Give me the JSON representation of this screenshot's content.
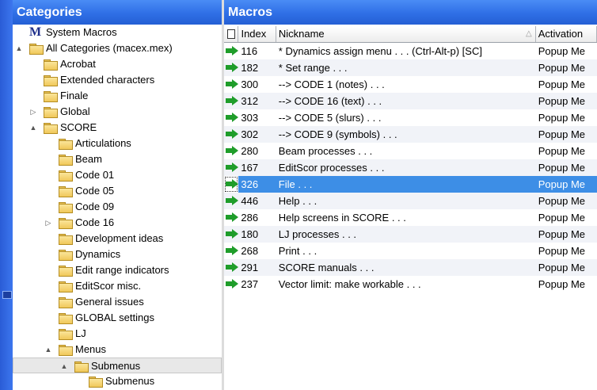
{
  "left_panel": {
    "title": "Categories",
    "tree": [
      {
        "label": "System Macros",
        "level": 0,
        "icon": "m-logo-icon",
        "expander": ""
      },
      {
        "label": "All Categories (macex.mex)",
        "level": 0,
        "icon": "folder-icon",
        "expander": "▲"
      },
      {
        "label": "Acrobat",
        "level": 1,
        "icon": "folder-icon",
        "expander": ""
      },
      {
        "label": "Extended characters",
        "level": 1,
        "icon": "folder-icon",
        "expander": ""
      },
      {
        "label": "Finale",
        "level": 1,
        "icon": "folder-icon",
        "expander": ""
      },
      {
        "label": "Global",
        "level": 1,
        "icon": "folder-icon",
        "expander": "▷"
      },
      {
        "label": "SCORE",
        "level": 1,
        "icon": "folder-icon",
        "expander": "▲"
      },
      {
        "label": "Articulations",
        "level": 2,
        "icon": "folder-icon",
        "expander": ""
      },
      {
        "label": "Beam",
        "level": 2,
        "icon": "folder-icon",
        "expander": ""
      },
      {
        "label": "Code 01",
        "level": 2,
        "icon": "folder-icon",
        "expander": ""
      },
      {
        "label": "Code 05",
        "level": 2,
        "icon": "folder-icon",
        "expander": ""
      },
      {
        "label": "Code 09",
        "level": 2,
        "icon": "folder-icon",
        "expander": ""
      },
      {
        "label": "Code 16",
        "level": 2,
        "icon": "folder-icon",
        "expander": "▷"
      },
      {
        "label": "Development ideas",
        "level": 2,
        "icon": "folder-icon",
        "expander": ""
      },
      {
        "label": "Dynamics",
        "level": 2,
        "icon": "folder-icon",
        "expander": ""
      },
      {
        "label": "Edit range indicators",
        "level": 2,
        "icon": "folder-icon",
        "expander": ""
      },
      {
        "label": "EditScor misc.",
        "level": 2,
        "icon": "folder-icon",
        "expander": ""
      },
      {
        "label": "General issues",
        "level": 2,
        "icon": "folder-icon",
        "expander": ""
      },
      {
        "label": "GLOBAL settings",
        "level": 2,
        "icon": "folder-icon",
        "expander": ""
      },
      {
        "label": "LJ",
        "level": 2,
        "icon": "folder-icon",
        "expander": ""
      },
      {
        "label": "Menus",
        "level": 2,
        "icon": "folder-icon",
        "expander": "▲"
      },
      {
        "label": "Submenus",
        "level": 3,
        "icon": "folder-icon",
        "expander": "▲",
        "selected": true
      },
      {
        "label": "Submenus",
        "level": 4,
        "icon": "folder-icon",
        "expander": ""
      }
    ]
  },
  "right_panel": {
    "title": "Macros",
    "columns": {
      "icon": "",
      "index": "Index",
      "nickname": "Nickname",
      "activation": "Activation",
      "sort_indicator": "△"
    },
    "rows": [
      {
        "index": "116",
        "nickname": "* Dynamics assign menu . . . (Ctrl-Alt-p) [SC]",
        "activation": "Popup Me"
      },
      {
        "index": "182",
        "nickname": "* Set range . . .",
        "activation": "Popup Me"
      },
      {
        "index": "300",
        "nickname": "--> CODE 1 (notes) . . .",
        "activation": "Popup Me"
      },
      {
        "index": "312",
        "nickname": "--> CODE 16 (text) . . .",
        "activation": "Popup Me"
      },
      {
        "index": "303",
        "nickname": "--> CODE 5 (slurs) . . .",
        "activation": "Popup Me"
      },
      {
        "index": "302",
        "nickname": "--> CODE 9 (symbols) . . .",
        "activation": "Popup Me"
      },
      {
        "index": "280",
        "nickname": "Beam processes . . .",
        "activation": "Popup Me"
      },
      {
        "index": "167",
        "nickname": "EditScor processes . . .",
        "activation": "Popup Me"
      },
      {
        "index": "326",
        "nickname": "File . . .",
        "activation": "Popup Me",
        "selected": true
      },
      {
        "index": "446",
        "nickname": "Help . . .",
        "activation": "Popup Me"
      },
      {
        "index": "286",
        "nickname": "Help screens in SCORE . . .",
        "activation": "Popup Me"
      },
      {
        "index": "180",
        "nickname": "LJ processes . . .",
        "activation": "Popup Me"
      },
      {
        "index": "268",
        "nickname": "Print . . .",
        "activation": "Popup Me"
      },
      {
        "index": "291",
        "nickname": "SCORE manuals . . .",
        "activation": "Popup Me"
      },
      {
        "index": "237",
        "nickname": "Vector limit: make workable . . .",
        "activation": "Popup Me"
      }
    ]
  },
  "colors": {
    "header": "#2f6fe6",
    "selection": "#3d8ee6",
    "macro_arrow": "#1f9d2a",
    "folder": "#f0c85a"
  }
}
